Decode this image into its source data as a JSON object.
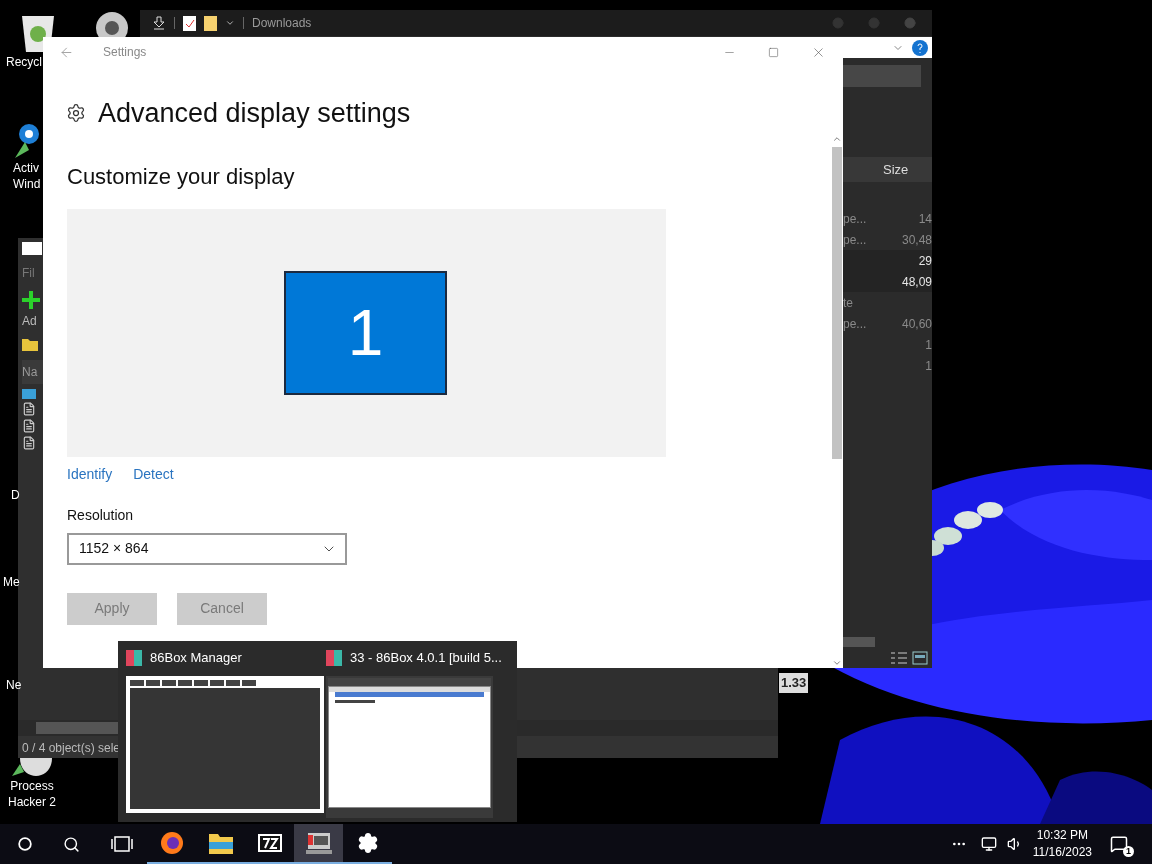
{
  "desktop": {
    "icons": [
      {
        "kind": "recycle",
        "lines": [
          "Recycl"
        ]
      },
      {
        "kind": "active",
        "lines": [
          "Activ",
          "Wind"
        ]
      },
      {
        "kind": "plain",
        "lines": [
          "D"
        ]
      },
      {
        "kind": "plain",
        "lines": [
          "Me"
        ]
      },
      {
        "kind": "plain",
        "lines": [
          "Ne"
        ]
      },
      {
        "kind": "hacker",
        "lines": [
          "Process",
          "Hacker 2"
        ]
      }
    ]
  },
  "explorer": {
    "title": "Downloads",
    "column": "Size",
    "rows": [
      {
        "type": "pe...",
        "size": "14",
        "selected": false
      },
      {
        "type": "pe...",
        "size": "30,48",
        "selected": false
      },
      {
        "size": "29",
        "selected": true
      },
      {
        "size": "48,09",
        "selected": true
      },
      {
        "type": "te",
        "selected": false
      },
      {
        "type": "pe...",
        "size": "40,60",
        "selected": false
      },
      {
        "size": "1",
        "selected": false
      },
      {
        "size": "1",
        "selected": false
      }
    ]
  },
  "archiver": {
    "menu": "Fil",
    "toolbar": "Ad",
    "column": "Na",
    "status": "0 / 4 object(s) sele",
    "badge": "1.33"
  },
  "settings": {
    "title": "Settings",
    "heading": "Advanced display settings",
    "section": "Customize your display",
    "monitor": {
      "number": "1",
      "selected": true
    },
    "links": [
      "Identify",
      "Detect"
    ],
    "resolution": {
      "label": "Resolution",
      "value": "1152 × 864"
    },
    "buttons": [
      {
        "label": "Apply",
        "disabled": true
      },
      {
        "label": "Cancel",
        "disabled": true
      }
    ]
  },
  "thumbnails": [
    {
      "kind": "manager",
      "title": "86Box Manager"
    },
    {
      "kind": "emulator",
      "title": "33 - 86Box 4.0.1 [build 5..."
    }
  ],
  "taskbar": {
    "apps": [
      {
        "kind": "firefox",
        "selected": false
      },
      {
        "kind": "explorer",
        "selected": false
      },
      {
        "kind": "archiver",
        "selected": false
      },
      {
        "kind": "emulator",
        "selected": true
      },
      {
        "kind": "settings",
        "selected": false
      }
    ],
    "time": "10:32 PM",
    "date": "11/16/2023",
    "notifications": "1"
  }
}
